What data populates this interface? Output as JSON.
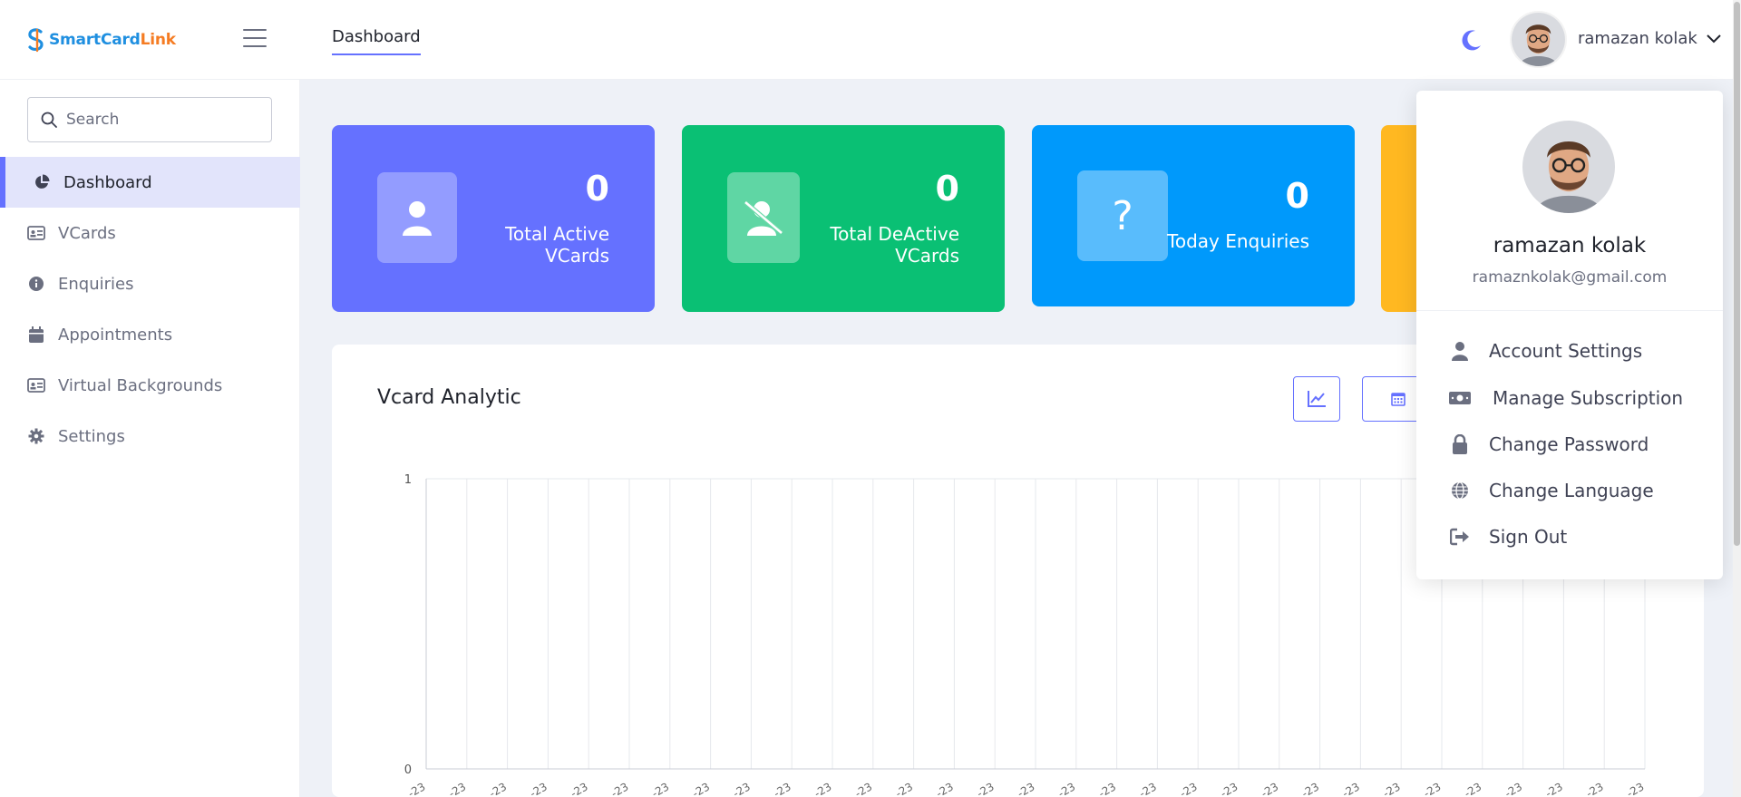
{
  "brand": {
    "part1": "SmartCard",
    "part2": "Link"
  },
  "header": {
    "tab": "Dashboard",
    "user_name": "ramazan kolak"
  },
  "sidebar": {
    "search_placeholder": "Search",
    "items": [
      {
        "label": "Dashboard",
        "icon": "pie-chart-icon",
        "active": true
      },
      {
        "label": "VCards",
        "icon": "id-card-icon"
      },
      {
        "label": "Enquiries",
        "icon": "info-icon"
      },
      {
        "label": "Appointments",
        "icon": "calendar-icon"
      },
      {
        "label": "Virtual Backgrounds",
        "icon": "id-card-icon"
      },
      {
        "label": "Settings",
        "icon": "gear-icon"
      }
    ]
  },
  "cards": [
    {
      "value": "0",
      "label_line1": "Total Active",
      "label_line2": "VCards",
      "color": "#6571ff",
      "icon": "user-icon"
    },
    {
      "value": "0",
      "label_line1": "Total DeActive",
      "label_line2": "VCards",
      "color": "#0ac074",
      "icon": "user-slash-icon"
    },
    {
      "value": "0",
      "label_line1": "Today Enquiries",
      "label_line2": "",
      "color": "#0099fb",
      "icon": "question-icon"
    },
    {
      "value": "",
      "label_line1": "",
      "label_line2": "",
      "color": "#ffb821",
      "icon": ""
    }
  ],
  "analytics": {
    "title": "Vcard Analytic"
  },
  "chart_data": {
    "type": "line",
    "ylim": [
      0,
      1
    ],
    "ytick_labels": [
      "1",
      "0"
    ],
    "x_tick_count": 31,
    "x_tick_label_fragment": "-23",
    "series": []
  },
  "dropdown": {
    "name": "ramazan kolak",
    "email": "ramaznkolak@gmail.com",
    "items": [
      {
        "label": "Account Settings",
        "icon": "user-icon"
      },
      {
        "label": "Manage Subscription",
        "icon": "money-bill-icon"
      },
      {
        "label": "Change Password",
        "icon": "lock-icon"
      },
      {
        "label": "Change Language",
        "icon": "globe-icon"
      },
      {
        "label": "Sign Out",
        "icon": "sign-out-icon"
      }
    ]
  },
  "colors": {
    "accent": "#6571ff",
    "green": "#0ac074",
    "blue": "#0099fb",
    "orange": "#ffb821"
  }
}
